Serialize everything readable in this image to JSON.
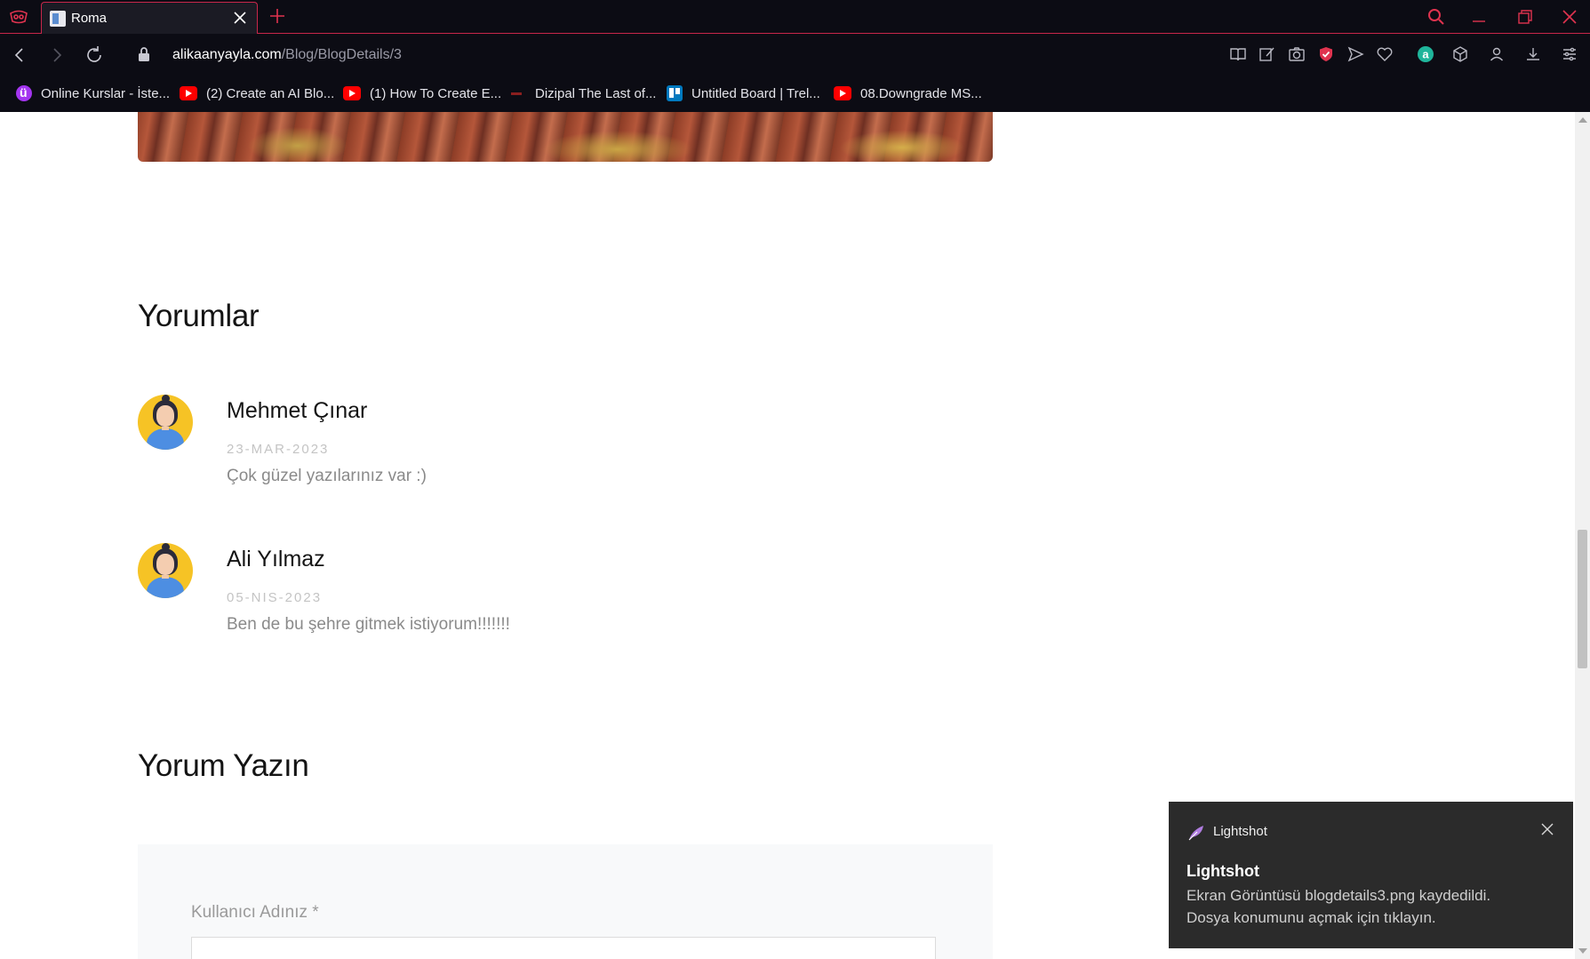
{
  "browser": {
    "tab": {
      "title": "Roma"
    },
    "url": {
      "host": "alikaanyayla.com",
      "path": "/Blog/BlogDetails/3"
    },
    "bookmarks": [
      {
        "label": "Online Kurslar - İste...",
        "icon": "udemy-icon"
      },
      {
        "label": "(2) Create an AI Blo...",
        "icon": "youtube-icon"
      },
      {
        "label": "(1) How To Create E...",
        "icon": "youtube-icon"
      },
      {
        "label": "Dizipal The Last of...",
        "icon": "dizipal-icon"
      },
      {
        "label": "Untitled Board | Trel...",
        "icon": "trello-icon"
      },
      {
        "label": "08.Downgrade MS...",
        "icon": "youtube-icon"
      }
    ],
    "accent_color": "#e0334f"
  },
  "page": {
    "comments_heading": "Yorumlar",
    "comments": [
      {
        "name": "Mehmet Çınar",
        "date": "23-MAR-2023",
        "text": "Çok güzel yazılarınız var :)"
      },
      {
        "name": "Ali Yılmaz",
        "date": "05-NIS-2023",
        "text": "Ben de bu şehre gitmek istiyorum!!!!!!!"
      }
    ],
    "write_heading": "Yorum Yazın",
    "form": {
      "username_label": "Kullanıcı Adınız *"
    }
  },
  "toast": {
    "app": "Lightshot",
    "title": "Lightshot",
    "line1": "Ekran Görüntüsü blogdetails3.png kaydedildi.",
    "line2": "Dosya konumunu açmak için tıklayın."
  }
}
